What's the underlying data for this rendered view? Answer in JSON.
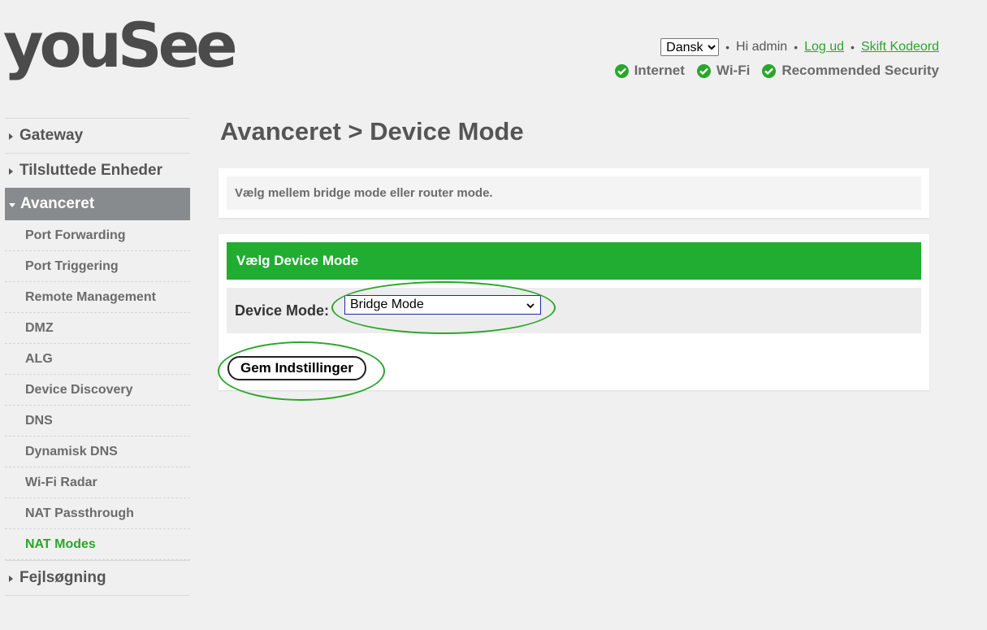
{
  "brand": {
    "logo_text": "youSee"
  },
  "header": {
    "language": {
      "selected": "Dansk",
      "options": [
        "Dansk"
      ]
    },
    "greeting": "Hi admin",
    "logout_label": "Log ud",
    "change_password_label": "Skift Kodeord",
    "separator": "•",
    "status": [
      {
        "label": "Internet",
        "icon": "check-circle-icon"
      },
      {
        "label": "Wi-Fi",
        "icon": "check-circle-icon"
      },
      {
        "label": "Recommended Security",
        "icon": "check-circle-icon"
      }
    ]
  },
  "sidebar": {
    "top_items": [
      "Gateway",
      "Tilsluttede Enheder",
      "Avanceret",
      "Fejlsøgning"
    ],
    "active_top": "Avanceret",
    "sub_items": [
      "Port Forwarding",
      "Port Triggering",
      "Remote Management",
      "DMZ",
      "ALG",
      "Device Discovery",
      "DNS",
      "Dynamisk DNS",
      "Wi-Fi Radar",
      "NAT Passthrough",
      "NAT Modes"
    ],
    "active_sub": "NAT Modes"
  },
  "main": {
    "title": "Avanceret > Device Mode",
    "description": "Vælg mellem bridge mode eller router mode.",
    "section_title": "Vælg Device Mode",
    "field_label": "Device Mode:",
    "mode_selected": "Bridge Mode",
    "save_label": "Gem Indstillinger"
  },
  "colors": {
    "accent_green": "#20ad32",
    "link_green": "#2aa62a",
    "nav_active_bg": "#888b8d",
    "select_border": "#1a2da6"
  }
}
